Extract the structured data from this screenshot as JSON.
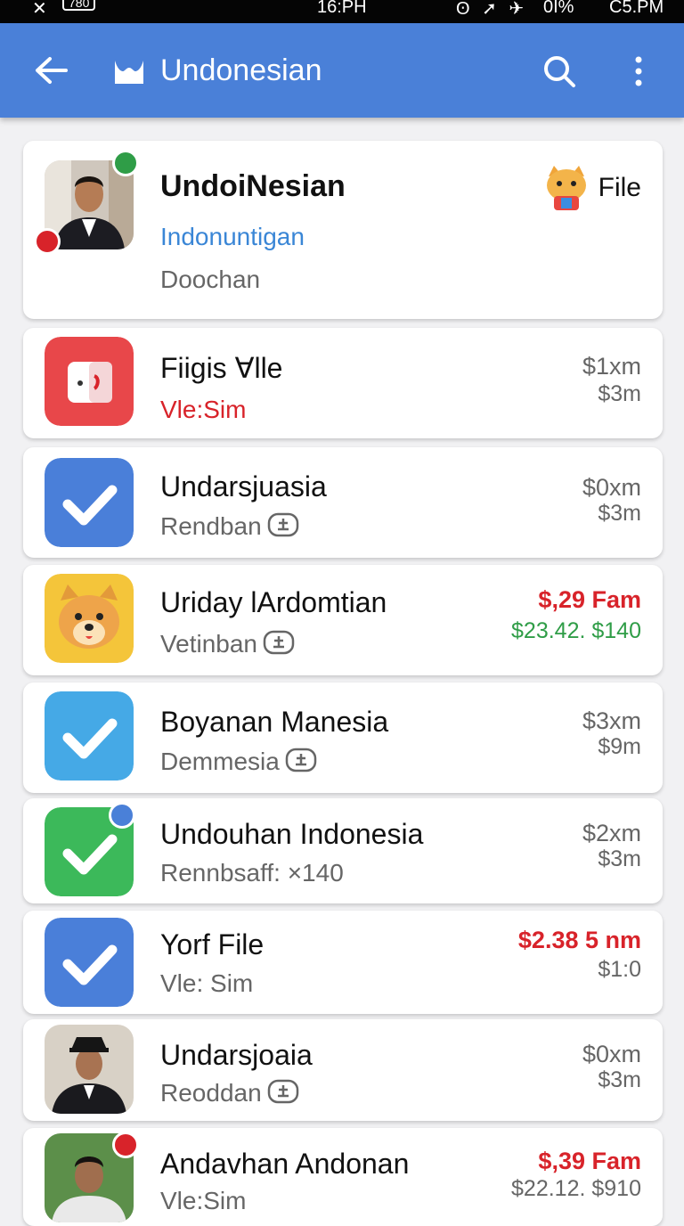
{
  "status_bar": {
    "left_icon": "x-icon",
    "left_badge": "780",
    "time": "16:PH",
    "right_percent": "0I%",
    "right_text": "C5.PM"
  },
  "app_bar": {
    "title": "Undonesian",
    "back_icon": "arrow-left-icon",
    "logo_icon": "bag-icon",
    "search_icon": "search-icon",
    "more_icon": "more-vertical-icon",
    "color": "#4a80d8"
  },
  "header_card": {
    "title": "UndoiNesian",
    "subtitle_link": "Indonuntigan",
    "detail": "Doochan",
    "right_label": "File"
  },
  "items": [
    {
      "title": "Fiigis ∀lle",
      "subtitle": "Vle:Sim",
      "price_top": "$1xm",
      "price_bottom": "$3m"
    },
    {
      "title": "Undarsjuasia",
      "subtitle": "Rendban",
      "price_top": "$0xm",
      "price_bottom": "$3m"
    },
    {
      "title": "Uriday lArdomtian",
      "subtitle": "Vetinban",
      "price_top": "$,29 Fam",
      "price_bottom": "$23.42. $140"
    },
    {
      "title": "Boyanan Manesia",
      "subtitle": "Demmesia",
      "price_top": "$3xm",
      "price_bottom": "$9m"
    },
    {
      "title": "Undouhan Indonesia",
      "subtitle": "Rennbsaff: ×140",
      "price_top": "$2xm",
      "price_bottom": "$3m"
    },
    {
      "title": "Yorf File",
      "subtitle": "Vle: Sim",
      "price_top": "$2.38 5 nm",
      "price_bottom": "$1:0"
    },
    {
      "title": "Undarsjoaia",
      "subtitle": "Reoddan",
      "price_top": "$0xm",
      "price_bottom": "$3m"
    },
    {
      "title": "Andavhan Andonan",
      "subtitle": "Vle:Sim",
      "price_top": "$,39 Fam",
      "price_bottom": "$22.12. $910"
    }
  ],
  "colors": {
    "accent_red": "#d8232a",
    "accent_green": "#2f9d47",
    "link_blue": "#3a86d6"
  }
}
